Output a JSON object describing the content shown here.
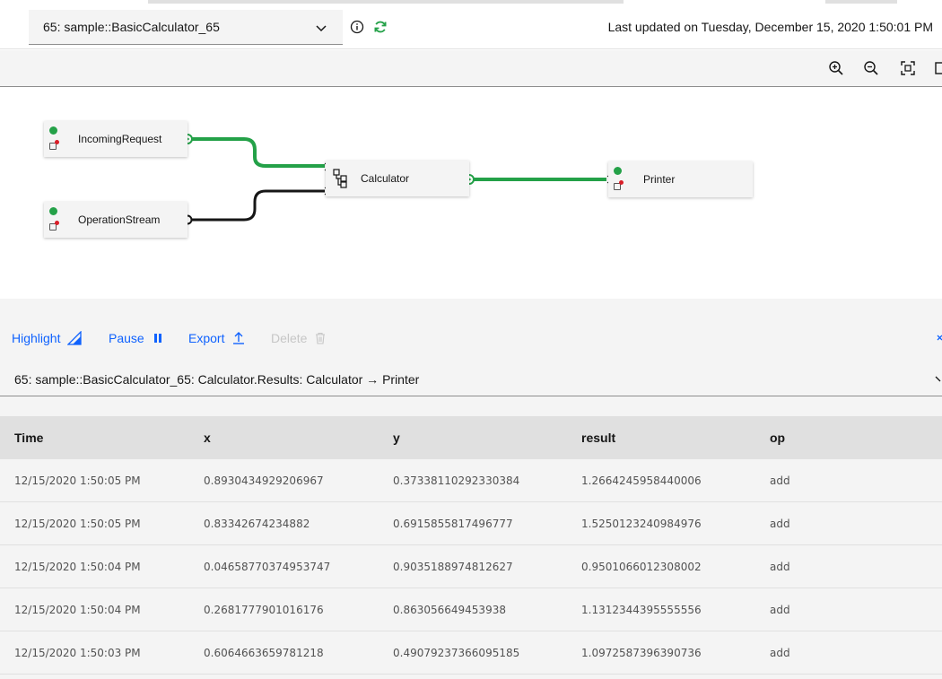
{
  "header": {
    "job_name": "65: sample::BasicCalculator_65",
    "last_updated": "Last updated on Tuesday, December 15, 2020 1:50:01 PM",
    "icons": [
      "info-icon",
      "refresh-icon",
      "chevron-down-icon"
    ]
  },
  "graph_toolbar": {
    "buttons": [
      "zoom-in-icon",
      "zoom-out-icon",
      "fit-to-screen-icon",
      "panel-icon"
    ]
  },
  "graph": {
    "nodes": {
      "incoming": "IncomingRequest",
      "operation": "OperationStream",
      "calculator": "Calculator",
      "printer": "Printer"
    },
    "colors": {
      "healthy": "#24a148",
      "flow": "#24a148",
      "idle": "#161616"
    }
  },
  "actions": {
    "highlight": "Highlight",
    "pause": "Pause",
    "export": "Export",
    "delete": "Delete"
  },
  "stream": {
    "label": "65: sample::BasicCalculator_65: Calculator.Results: Calculator → Printer"
  },
  "table": {
    "columns": [
      "Time",
      "x",
      "y",
      "result",
      "op"
    ],
    "rows": [
      [
        "12/15/2020 1:50:05 PM",
        "0.8930434929206967",
        "0.37338110292330384",
        "1.2664245958440006",
        "add"
      ],
      [
        "12/15/2020 1:50:05 PM",
        "0.83342674234882",
        "0.6915855817496777",
        "1.5250123240984976",
        "add"
      ],
      [
        "12/15/2020 1:50:04 PM",
        "0.04658770374953747",
        "0.9035188974812627",
        "0.9501066012308002",
        "add"
      ],
      [
        "12/15/2020 1:50:04 PM",
        "0.2681777901016176",
        "0.863056649453938",
        "1.1312344395555556",
        "add"
      ],
      [
        "12/15/2020 1:50:03 PM",
        "0.6064663659781218",
        "0.49079237366095185",
        "1.0972587396390736",
        "add"
      ]
    ]
  }
}
